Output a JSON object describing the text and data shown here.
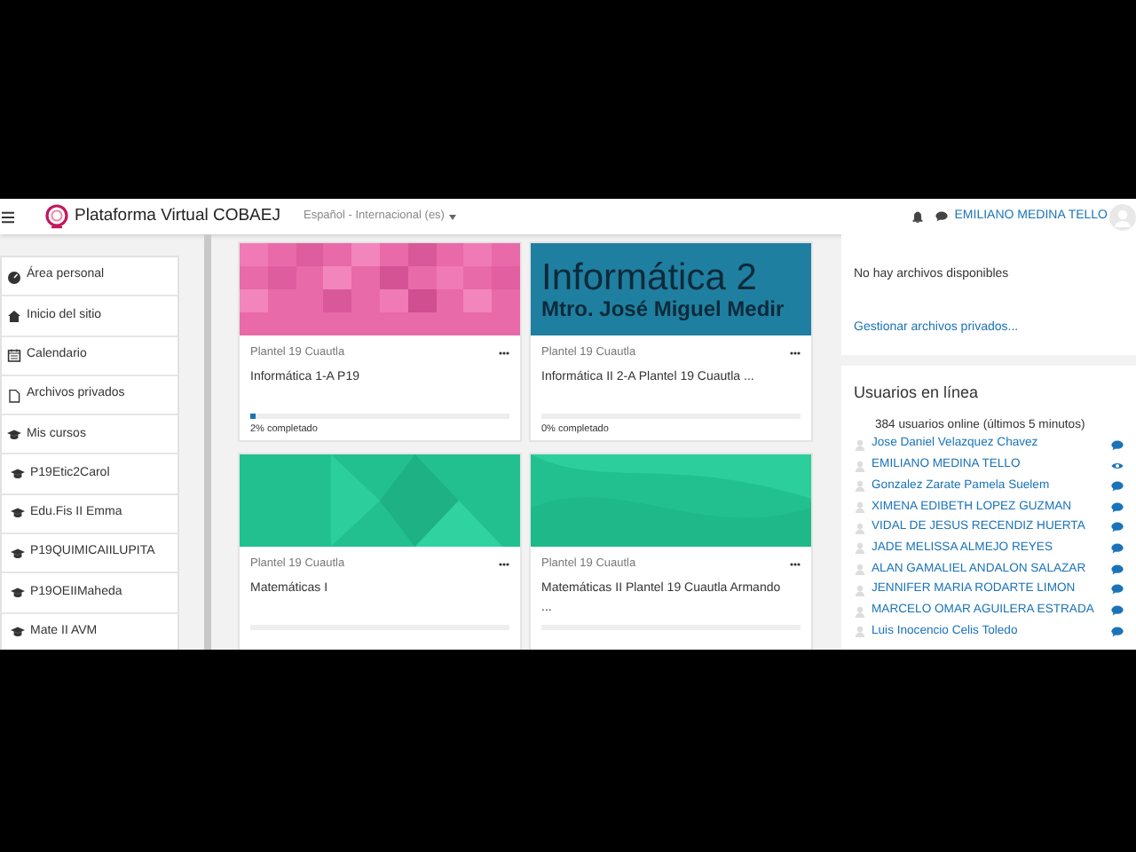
{
  "navbar": {
    "title": "Plataforma Virtual COBAEJ",
    "language": "Español ‎- Internacional ‎(es)‎",
    "user_name": "EMILIANO MEDINA TELLO"
  },
  "sidebar": {
    "items": [
      {
        "label": "Área personal",
        "kind": "dashboard"
      },
      {
        "label": "Inicio del sitio",
        "kind": "home"
      },
      {
        "label": "Calendario",
        "kind": "calendar"
      },
      {
        "label": "Archivos privados",
        "kind": "file"
      },
      {
        "label": "Mis cursos",
        "kind": "courses",
        "children": [
          {
            "label": "P19Etic2Carol",
            "kind": "course"
          },
          {
            "label": "Edu.Fis II Emma",
            "kind": "course"
          },
          {
            "label": "P19QUIMICAIILUPITA",
            "kind": "course"
          },
          {
            "label": "P19OEIIMaheda",
            "kind": "course"
          },
          {
            "label": "Mate II AVM",
            "kind": "course"
          }
        ]
      }
    ]
  },
  "course_rows": [
    {
      "courses": [
        {
          "kind": "pink",
          "category": "Plantel 19 Cuautla",
          "title": "Informática 1-A P19",
          "level": 0.02,
          "progress_text": "2% completado"
        },
        {
          "kind": "teal",
          "banner_title": "Informática 2",
          "banner_subtitle": "Mtro. José Miguel Medir",
          "category": "Plantel 19 Cuautla",
          "title": "Informática II 2-A Plantel 19 Cuautla ...",
          "level": 0,
          "progress_text": "0% completado"
        }
      ]
    },
    {
      "courses": [
        {
          "kind": "green",
          "category": "Plantel 19 Cuautla",
          "title": "Matemáticas I",
          "level": 0
        },
        {
          "kind": "wave",
          "category": "Plantel 19 Cuautla",
          "title": "Matemáticas II Plantel 19 Cuautla Armando ...",
          "level": 0
        }
      ]
    }
  ],
  "private_files": {
    "message": "No hay archivos disponibles",
    "link": "Gestionar archivos privados..."
  },
  "online_users": {
    "title": "Usuarios en línea",
    "count": "384 usuarios online (últimos 5 minutos)",
    "users": [
      {
        "name": "Jose Daniel Velazquez Chavez",
        "kind": "message"
      },
      {
        "name": "EMILIANO MEDINA TELLO",
        "kind": "self"
      },
      {
        "name": "Gonzalez Zarate Pamela Suelem",
        "kind": "message"
      },
      {
        "name": "XIMENA EDIBETH LOPEZ GUZMAN",
        "kind": "message"
      },
      {
        "name": "VIDAL DE JESUS RECENDIZ HUERTA",
        "kind": "message"
      },
      {
        "name": "JADE MELISSA ALMEJO REYES",
        "kind": "message"
      },
      {
        "name": "ALAN GAMALIEL ANDALON SALAZAR",
        "kind": "message"
      },
      {
        "name": "JENNIFER MARIA RODARTE LIMON",
        "kind": "message"
      },
      {
        "name": "MARCELO OMAR AGUILERA ESTRADA",
        "kind": "message"
      },
      {
        "name": "Luis Inocencio Celis Toledo",
        "kind": "message"
      }
    ]
  }
}
